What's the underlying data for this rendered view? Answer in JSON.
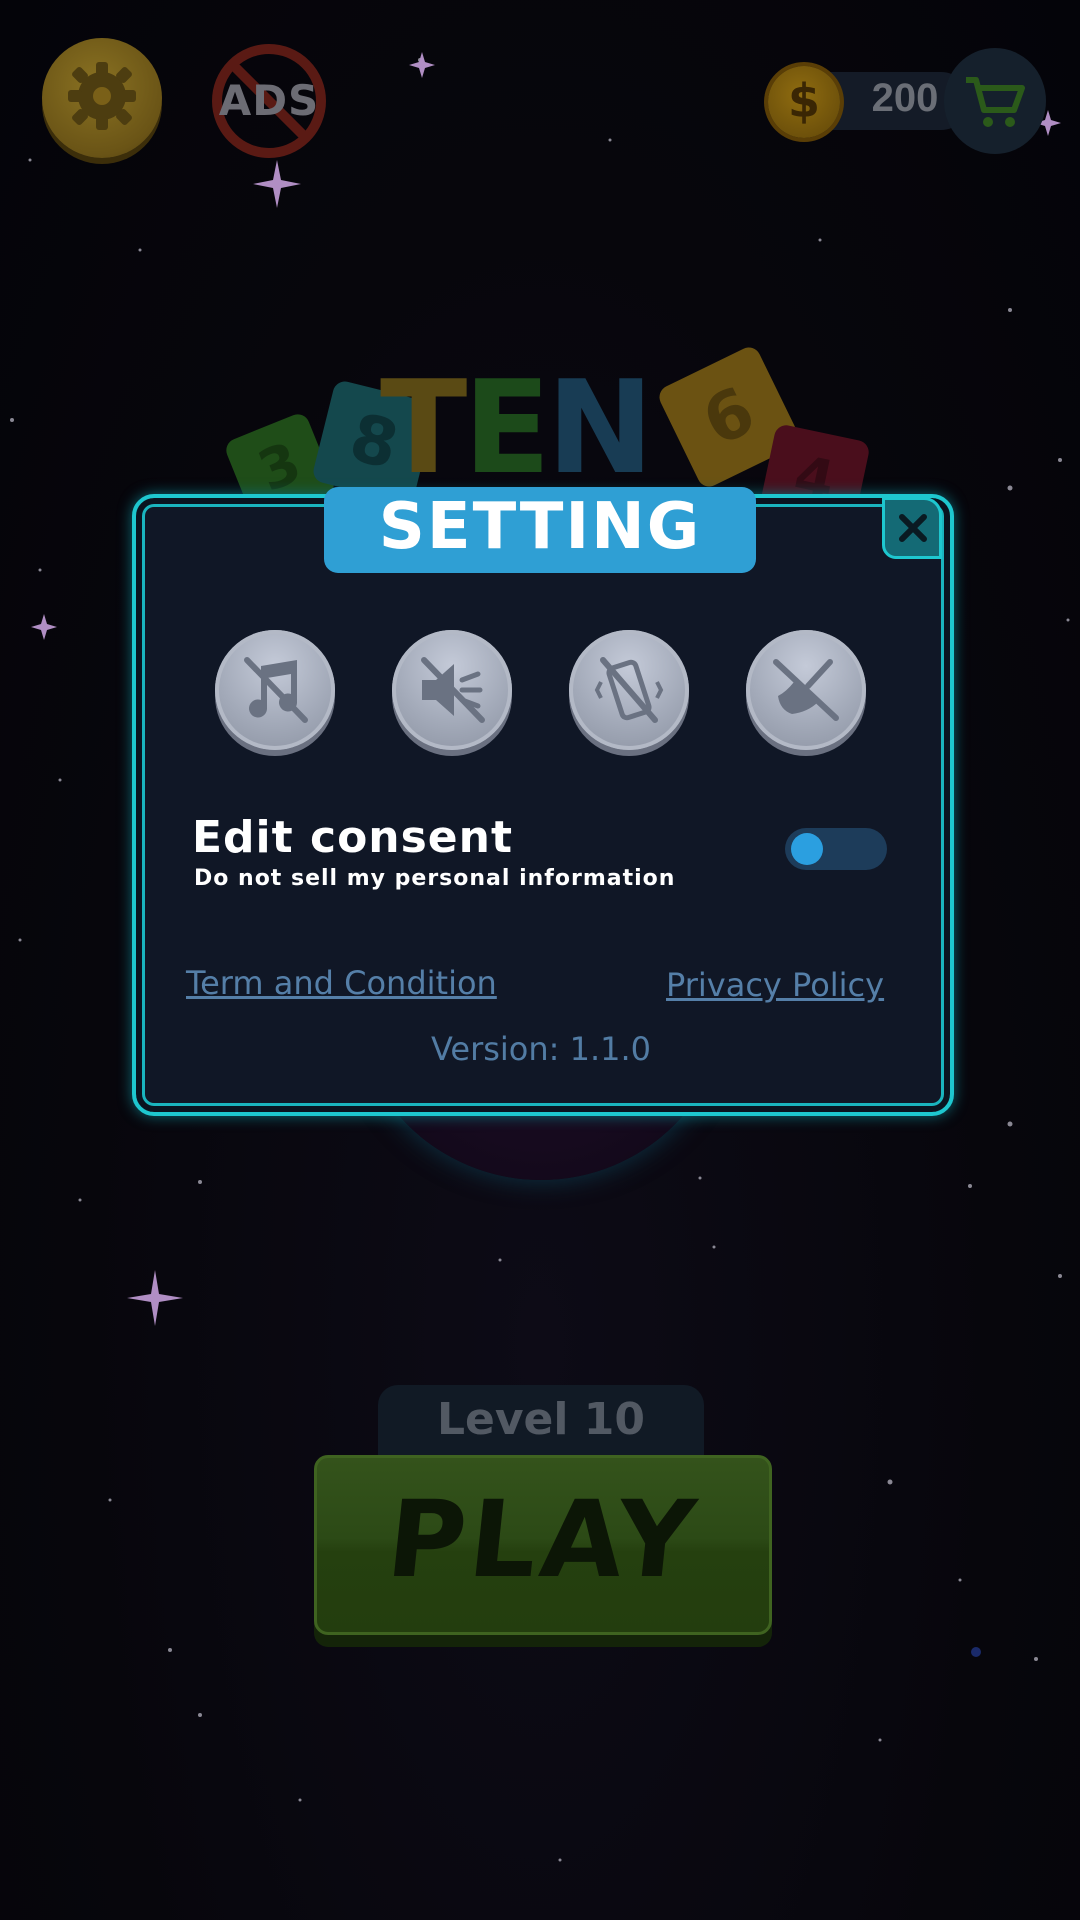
{
  "header": {
    "settings_icon": "gear-icon",
    "ads_label": "ADS",
    "coin_count": "200",
    "coin_symbol": "$",
    "cart_icon": "cart-icon"
  },
  "logo": {
    "title_part1": "T",
    "title_part2": "E",
    "title_part3": "N",
    "tiles": [
      "3",
      "8",
      "6",
      "4"
    ]
  },
  "main": {
    "level_label": "Level 10",
    "play_label": "PLAY"
  },
  "modal": {
    "title": "SETTING",
    "close_icon": "close-icon",
    "toggles": [
      {
        "name": "music-off-icon",
        "state": "off"
      },
      {
        "name": "sound-off-icon",
        "state": "off"
      },
      {
        "name": "vibration-off-icon",
        "state": "off"
      },
      {
        "name": "notification-off-icon",
        "state": "off"
      }
    ],
    "consent_title": "Edit consent",
    "consent_subtitle": "Do not sell my personal information",
    "consent_toggle_state": "off",
    "terms_link": "Term and Condition",
    "privacy_link": "Privacy Policy",
    "version": "Version: 1.1.0"
  },
  "colors": {
    "modal_border": "#1ec7cf",
    "title_bar": "#2f9fd4",
    "link": "#557fa8",
    "toggle_knob": "#2b9fe0"
  }
}
